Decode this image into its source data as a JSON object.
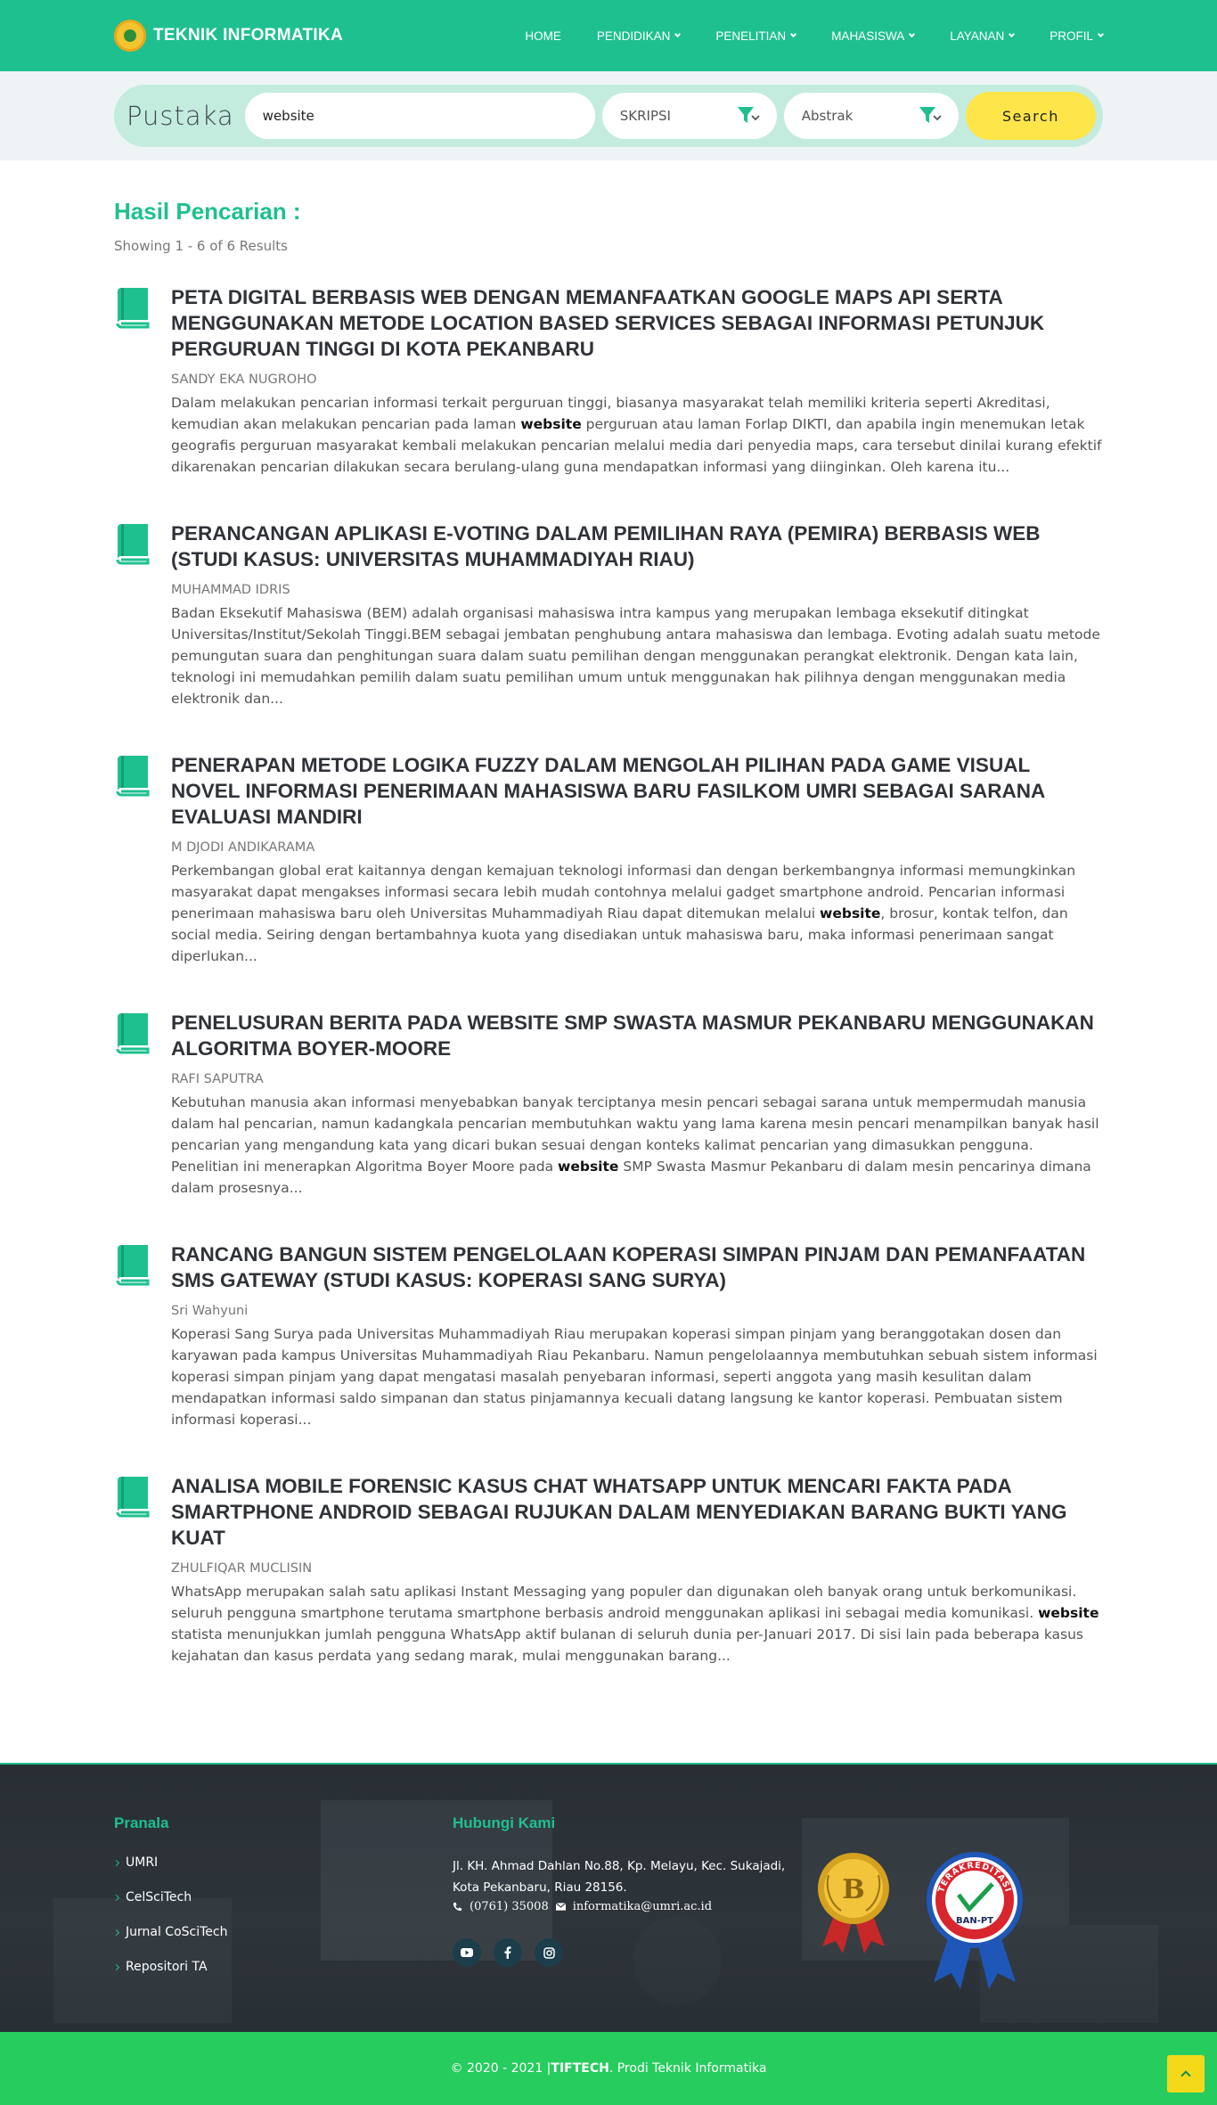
{
  "brand": {
    "name": "TEKNIK INFORMATIKA"
  },
  "nav": {
    "items": [
      {
        "label": "HOME",
        "has_caret": false
      },
      {
        "label": "PENDIDIKAN",
        "has_caret": true
      },
      {
        "label": "PENELITIAN",
        "has_caret": true
      },
      {
        "label": "MAHASISWA",
        "has_caret": true
      },
      {
        "label": "LAYANAN",
        "has_caret": true
      },
      {
        "label": "PROFIL",
        "has_caret": true
      }
    ]
  },
  "search": {
    "label": "Pustaka",
    "query": "website",
    "type_select": "SKRIPSI",
    "field_select": "Abstrak",
    "button": "Search"
  },
  "results": {
    "heading": "Hasil Pencarian :",
    "count_text": "Showing 1 - 6 of 6 Results",
    "items": [
      {
        "title": "PETA DIGITAL BERBASIS WEB DENGAN MEMANFAATKAN GOOGLE MAPS API SERTA MENGGUNAKAN METODE LOCATION BASED SERVICES SEBAGAI INFORMASI PETUNJUK PERGURUAN TINGGI DI KOTA PEKANBARU",
        "author": "SANDY EKA NUGROHO",
        "abstract_before": "Dalam melakukan pencarian informasi terkait perguruan tinggi, biasanya masyarakat telah memiliki kriteria seperti Akreditasi, kemudian akan melakukan pencarian pada laman ",
        "highlight": "website",
        "abstract_after": " perguruan atau laman Forlap DIKTI, dan apabila ingin menemukan letak geografis perguruan masyarakat kembali melakukan pencarian melalui media dari penyedia maps, cara tersebut dinilai kurang efektif dikarenakan pencarian dilakukan secara berulang-ulang guna mendapatkan informasi yang diinginkan. Oleh karena itu..."
      },
      {
        "title": "PERANCANGAN APLIKASI E-VOTING DALAM PEMILIHAN RAYA (PEMIRA) BERBASIS WEB (STUDI KASUS: UNIVERSITAS MUHAMMADIYAH RIAU)",
        "author": "MUHAMMAD IDRIS",
        "abstract_before": "Badan Eksekutif Mahasiswa (BEM) adalah organisasi mahasiswa intra kampus yang merupakan lembaga eksekutif ditingkat Universitas/Institut/Sekolah Tinggi.BEM sebagai jembatan penghubung antara mahasiswa dan lembaga. Evoting adalah suatu metode pemungutan suara dan penghitungan suara dalam suatu pemilihan dengan menggunakan perangkat elektronik. Dengan kata lain, teknologi ini memudahkan pemilih dalam suatu pemilihan umum untuk menggunakan hak pilihnya dengan menggunakan media elektronik dan...",
        "highlight": "",
        "abstract_after": ""
      },
      {
        "title": "PENERAPAN METODE LOGIKA FUZZY DALAM MENGOLAH PILIHAN PADA GAME VISUAL NOVEL INFORMASI PENERIMAAN MAHASISWA BARU FASILKOM UMRI SEBAGAI SARANA EVALUASI MANDIRI",
        "author": "M DJODI ANDIKARAMA",
        "abstract_before": "Perkembangan global erat kaitannya dengan kemajuan teknologi informasi dan dengan berkembangnya informasi memungkinkan masyarakat dapat mengakses informasi secara lebih mudah contohnya melalui gadget smartphone android.  Pencarian informasi penerimaan mahasiswa baru oleh Universitas Muhammadiyah Riau dapat ditemukan melalui ",
        "highlight": "website",
        "abstract_after": ", brosur, kontak telfon, dan social media. Seiring dengan bertambahnya kuota yang disediakan untuk mahasiswa baru, maka informasi penerimaan sangat diperlukan..."
      },
      {
        "title": "PENELUSURAN BERITA PADA WEBSITE SMP SWASTA MASMUR PEKANBARU MENGGUNAKAN ALGORITMA BOYER-MOORE",
        "author": "RAFI SAPUTRA",
        "abstract_before": "Kebutuhan manusia akan informasi menyebabkan banyak terciptanya mesin pencari sebagai sarana untuk mempermudah manusia dalam hal pencarian, namun kadangkala pencarian membutuhkan waktu yang lama karena mesin pencari menampilkan banyak hasil pencarian yang mengandung kata yang dicari bukan sesuai dengan konteks kalimat pencarian yang dimasukkan pengguna. Penelitian ini menerapkan Algoritma Boyer Moore pada ",
        "highlight": "website",
        "abstract_after": " SMP Swasta Masmur Pekanbaru di dalam mesin pencarinya dimana dalam prosesnya..."
      },
      {
        "title": "RANCANG BANGUN SISTEM PENGELOLAAN KOPERASI SIMPAN PINJAM DAN PEMANFAATAN SMS GATEWAY (STUDI KASUS: KOPERASI SANG SURYA)",
        "author": "Sri Wahyuni",
        "abstract_before": "Koperasi Sang Surya pada Universitas Muhammadiyah Riau merupakan koperasi simpan pinjam yang beranggotakan dosen dan karyawan pada kampus Universitas Muhammadiyah Riau Pekanbaru. Namun pengelolaannya membutuhkan sebuah sistem informasi koperasi simpan pinjam yang dapat mengatasi masalah penyebaran informasi, seperti anggota yang masih kesulitan dalam mendapatkan informasi saldo simpanan dan status pinjamannya kecuali datang langsung ke kantor koperasi. Pembuatan sistem informasi koperasi...",
        "highlight": "",
        "abstract_after": ""
      },
      {
        "title": "ANALISA MOBILE FORENSIC KASUS CHAT WHATSAPP UNTUK MENCARI FAKTA PADA SMARTPHONE ANDROID SEBAGAI RUJUKAN DALAM MENYEDIAKAN BARANG BUKTI YANG KUAT",
        "author": "ZHULFIQAR MUCLISIN",
        "abstract_before": "WhatsApp  merupakan salah satu aplikasi Instant Messaging yang populer dan digunakan oleh banyak orang untuk berkomunikasi. seluruh pengguna smartphone terutama smartphone berbasis android menggunakan  aplikasi  ini  sebagai media komunikasi. ",
        "highlight": "website",
        "abstract_after": " statista menunjukkan jumlah pengguna WhatsApp aktif bulanan di seluruh dunia per-Januari 2017. Di sisi lain pada beberapa kasus kejahatan dan kasus perdata yang sedang marak, mulai menggunakan barang..."
      }
    ]
  },
  "footer": {
    "links_heading": "Pranala",
    "links": [
      "UMRI",
      "CelSciTech",
      "Jurnal CoSciTech",
      "Repositori TA"
    ],
    "contact_heading": "Hubungi Kami",
    "address_line1": "Jl. KH. Ahmad Dahlan No.88, Kp. Melayu, Kec. Sukajadi,",
    "address_line2": "Kota Pekanbaru, Riau 28156.",
    "phone": "(0761)  35008",
    "email": "informatika@umri.ac.id",
    "socials": [
      "youtube-icon",
      "facebook-icon",
      "instagram-icon"
    ],
    "badge_b_letter": "B",
    "badge_banpt_arc": "TERAKREDITASI",
    "badge_banpt_label": "BAN-PT"
  },
  "bottom": {
    "copyright": "© 2020 - 2021 |",
    "brand": "TIFTECH",
    "suffix": ". Prodi Teknik Informatika"
  },
  "colors": {
    "primary": "#1ec08f",
    "bottom_bar": "#26cc5e",
    "search_button": "#fde54a",
    "footer_bg": "#2c3238"
  }
}
